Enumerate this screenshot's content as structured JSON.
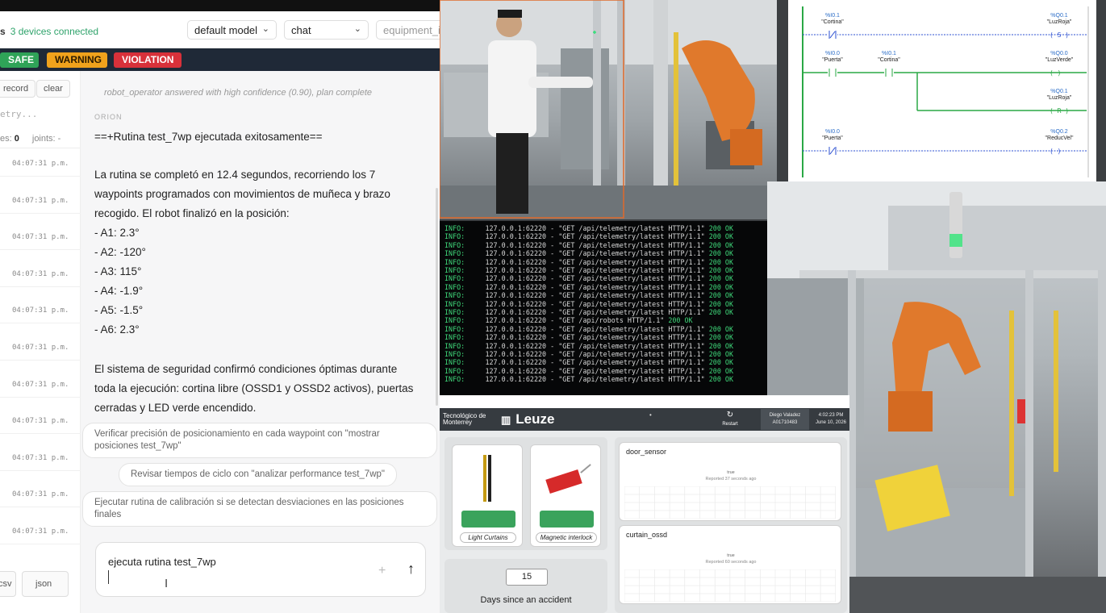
{
  "header": {
    "status_prefix": "s",
    "status_text": "3 devices connected",
    "model_select": "default model",
    "mode_select": "chat",
    "equipment_placeholder": "equipment_id"
  },
  "status_pills": [
    {
      "label": "SAFE",
      "color": "#2fa358"
    },
    {
      "label": "WARNING",
      "color": "#f0a21c"
    },
    {
      "label": "VIOLATION",
      "color": "#d8313a"
    }
  ],
  "left_panel": {
    "record_label": "record",
    "clear_label": "clear",
    "search_placeholder": "etry...",
    "counts_label": "es:",
    "counts_value": "0",
    "joints_label": "joints: -",
    "timestamps": [
      "04:07:31 p.m.",
      "04:07:31 p.m.",
      "04:07:31 p.m.",
      "04:07:31 p.m.",
      "04:07:31 p.m.",
      "04:07:31 p.m.",
      "04:07:31 p.m.",
      "04:07:31 p.m.",
      "04:07:31 p.m.",
      "04:07:31 p.m.",
      "04:07:31 p.m."
    ],
    "csv_label": "csv",
    "json_label": "json"
  },
  "chat": {
    "previous_message": "robot_operator answered with high confidence (0.90), plan complete",
    "sender": "ORION",
    "lines": [
      "==+Rutina test_7wp ejecutada exitosamente==",
      "",
      "La rutina se completó en 12.4 segundos, recorriendo los 7",
      "waypoints programados con movimientos de muñeca y brazo",
      "recogido. El robot finalizó en la posición:",
      "- A1: 2.3°",
      "- A2: -120°",
      "- A3: 115°",
      "- A4: -1.9°",
      "- A5: -1.5°",
      "- A6: 2.3°",
      "",
      "El sistema de seguridad confirmó condiciones óptimas durante",
      "toda la ejecución: cortina libre (OSSD1 y OSSD2 activos), puertas",
      "cerradas y LED verde encendido."
    ],
    "suggestions": [
      "Verificar precisión de posicionamiento en cada waypoint con \"mostrar posiciones test_7wp\"",
      "Revisar tiempos de ciclo con \"analizar performance test_7wp\"",
      "Ejecutar rutina de calibración si se detectan desviaciones en las posiciones finales"
    ],
    "input_value": "ejecuta rutina test_7wp",
    "add_symbol": "+",
    "send_symbol": "↑"
  },
  "ladder": {
    "rungs": [
      {
        "contacts": [
          {
            "addr": "%I0.1",
            "name": "\"Cortina\"",
            "type": "NC"
          }
        ],
        "coil": {
          "addr": "%Q0.1",
          "name": "\"LuzRoja\"",
          "type": "S"
        }
      },
      {
        "contacts": [
          {
            "addr": "%I0.0",
            "name": "\"Puerta\"",
            "type": "NO"
          },
          {
            "addr": "%I0.1",
            "name": "\"Cortina\"",
            "type": "NO"
          }
        ],
        "coil": {
          "addr": "%Q0.0",
          "name": "\"LuzVerde\"",
          "type": ""
        }
      },
      {
        "contacts": [],
        "coil": {
          "addr": "%Q0.1",
          "name": "\"LuzRoja\"",
          "type": "R"
        }
      },
      {
        "contacts": [
          {
            "addr": "%I0.0",
            "name": "\"Puerta\"",
            "type": "NC"
          }
        ],
        "coil": {
          "addr": "%Q0.2",
          "name": "\"ReducVel\"",
          "type": ""
        }
      }
    ]
  },
  "console": {
    "prefix": "INFO:",
    "latest_line": "127.0.0.1:62220 - \"GET /api/telemetry/latest HTTP/1.1\"",
    "robots_line": "127.0.0.1:62220 - \"GET /api/robots HTTP/1.1\"",
    "ok": "200 OK",
    "robots_index": 11,
    "line_count": 19
  },
  "dashboard": {
    "org": "Tecnológico de Monterrey",
    "brand": "Leuze",
    "restart_label": "Restart",
    "user_name": "Diego Valadez",
    "user_id": "A01710483",
    "time": "4:02:23 PM",
    "date": "June 10, 2026",
    "light_curtain_label": "Light Curtains",
    "interlock_label": "Magnetic interlock",
    "days_value": "15",
    "days_label": "Days since an accident",
    "sensors": [
      {
        "name": "door_sensor",
        "value": "true",
        "reported": "Reported 37 seconds ago"
      },
      {
        "name": "curtain_ossd",
        "value": "true",
        "reported": "Reported 60 seconds ago"
      }
    ]
  },
  "colors": {
    "accent_green": "#2fa36b",
    "dark_bar": "#1f2937",
    "robot_orange": "#e0792c"
  }
}
